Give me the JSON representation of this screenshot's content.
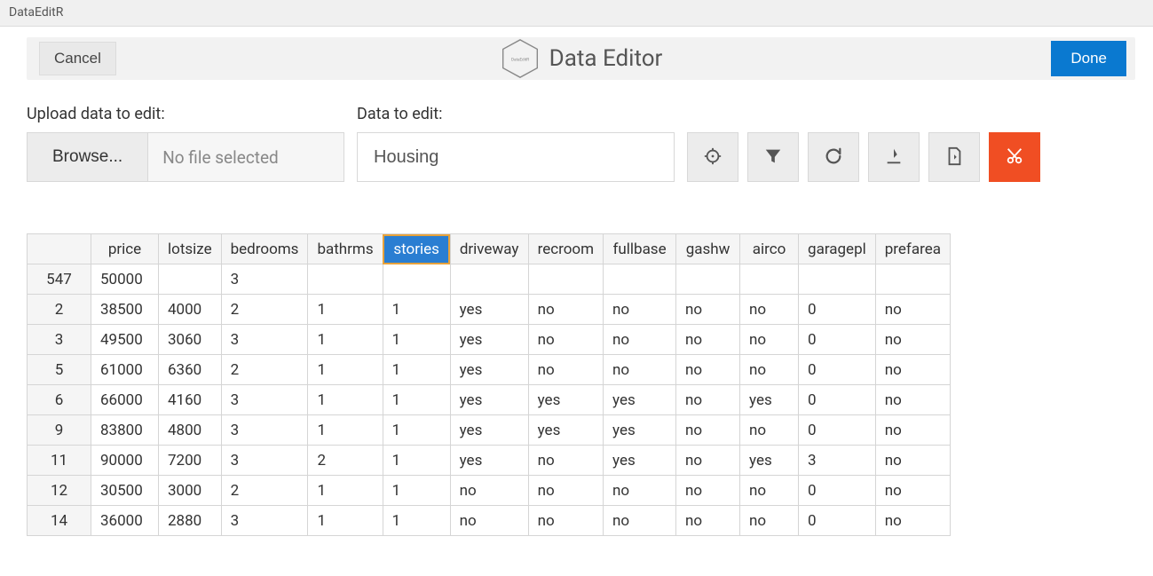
{
  "window": {
    "title": "DataEditR"
  },
  "header": {
    "cancel_label": "Cancel",
    "app_title": "Data Editor",
    "logo_text": "DataEditR",
    "done_label": "Done"
  },
  "upload": {
    "label": "Upload data to edit:",
    "browse_label": "Browse...",
    "file_status": "No file selected"
  },
  "datainput": {
    "label": "Data to edit:",
    "value": "Housing"
  },
  "toolbar_icons": {
    "crosshair": "crosshair-icon",
    "filter": "filter-icon",
    "refresh": "refresh-icon",
    "download": "download-icon",
    "save": "save-file-icon",
    "cut": "cut-icon"
  },
  "table": {
    "columns": [
      "price",
      "lotsize",
      "bedrooms",
      "bathrms",
      "stories",
      "driveway",
      "recroom",
      "fullbase",
      "gashw",
      "airco",
      "garagepl",
      "prefarea"
    ],
    "selected_column": "stories",
    "rows": [
      {
        "rownum": "547",
        "price": "50000",
        "lotsize": "",
        "bedrooms": "3",
        "bathrms": "",
        "stories": "",
        "driveway": "",
        "recroom": "",
        "fullbase": "",
        "gashw": "",
        "airco": "",
        "garagepl": "",
        "prefarea": ""
      },
      {
        "rownum": "2",
        "price": "38500",
        "lotsize": "4000",
        "bedrooms": "2",
        "bathrms": "1",
        "stories": "1",
        "driveway": "yes",
        "recroom": "no",
        "fullbase": "no",
        "gashw": "no",
        "airco": "no",
        "garagepl": "0",
        "prefarea": "no"
      },
      {
        "rownum": "3",
        "price": "49500",
        "lotsize": "3060",
        "bedrooms": "3",
        "bathrms": "1",
        "stories": "1",
        "driveway": "yes",
        "recroom": "no",
        "fullbase": "no",
        "gashw": "no",
        "airco": "no",
        "garagepl": "0",
        "prefarea": "no"
      },
      {
        "rownum": "5",
        "price": "61000",
        "lotsize": "6360",
        "bedrooms": "2",
        "bathrms": "1",
        "stories": "1",
        "driveway": "yes",
        "recroom": "no",
        "fullbase": "no",
        "gashw": "no",
        "airco": "no",
        "garagepl": "0",
        "prefarea": "no"
      },
      {
        "rownum": "6",
        "price": "66000",
        "lotsize": "4160",
        "bedrooms": "3",
        "bathrms": "1",
        "stories": "1",
        "driveway": "yes",
        "recroom": "yes",
        "fullbase": "yes",
        "gashw": "no",
        "airco": "yes",
        "garagepl": "0",
        "prefarea": "no"
      },
      {
        "rownum": "9",
        "price": "83800",
        "lotsize": "4800",
        "bedrooms": "3",
        "bathrms": "1",
        "stories": "1",
        "driveway": "yes",
        "recroom": "yes",
        "fullbase": "yes",
        "gashw": "no",
        "airco": "no",
        "garagepl": "0",
        "prefarea": "no"
      },
      {
        "rownum": "11",
        "price": "90000",
        "lotsize": "7200",
        "bedrooms": "3",
        "bathrms": "2",
        "stories": "1",
        "driveway": "yes",
        "recroom": "no",
        "fullbase": "yes",
        "gashw": "no",
        "airco": "yes",
        "garagepl": "3",
        "prefarea": "no"
      },
      {
        "rownum": "12",
        "price": "30500",
        "lotsize": "3000",
        "bedrooms": "2",
        "bathrms": "1",
        "stories": "1",
        "driveway": "no",
        "recroom": "no",
        "fullbase": "no",
        "gashw": "no",
        "airco": "no",
        "garagepl": "0",
        "prefarea": "no"
      },
      {
        "rownum": "14",
        "price": "36000",
        "lotsize": "2880",
        "bedrooms": "3",
        "bathrms": "1",
        "stories": "1",
        "driveway": "no",
        "recroom": "no",
        "fullbase": "no",
        "gashw": "no",
        "airco": "no",
        "garagepl": "0",
        "prefarea": "no"
      }
    ]
  }
}
